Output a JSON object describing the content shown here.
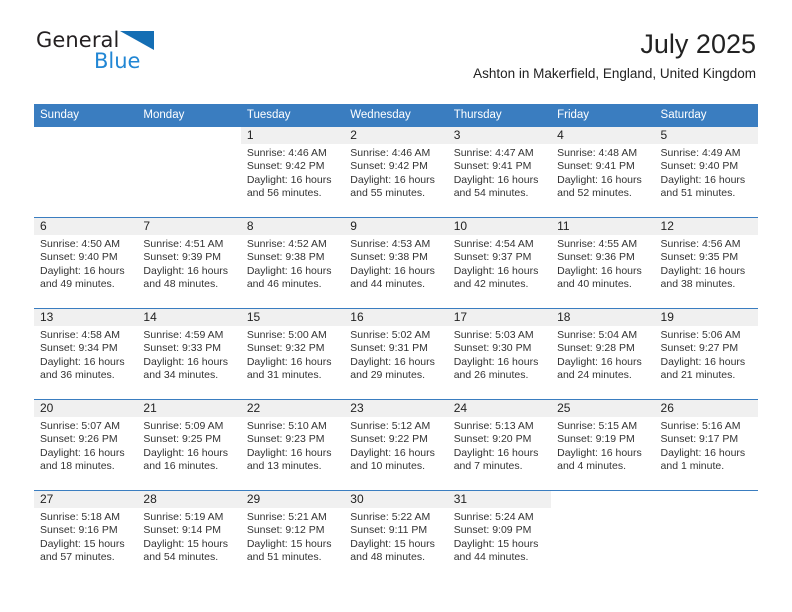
{
  "brand": {
    "name_top": "General",
    "name_bottom": "Blue",
    "accent_color": "#2186d4",
    "triangle_color": "#146eb4"
  },
  "header": {
    "month_title": "July 2025",
    "location": "Ashton in Makerfield, England, United Kingdom"
  },
  "calendar": {
    "header_bg": "#3a7dc0",
    "daynum_bg": "#f0f0f0",
    "weekday_headers": [
      "Sunday",
      "Monday",
      "Tuesday",
      "Wednesday",
      "Thursday",
      "Friday",
      "Saturday"
    ],
    "labels": {
      "sunrise": "Sunrise:",
      "sunset": "Sunset:",
      "daylight": "Daylight:"
    },
    "weeks": [
      [
        {
          "day": "",
          "blank": true
        },
        {
          "day": "",
          "blank": true
        },
        {
          "day": "1",
          "sunrise": "Sunrise: 4:46 AM",
          "sunset": "Sunset: 9:42 PM",
          "daylight_line1": "Daylight: 16 hours",
          "daylight_line2": "and 56 minutes."
        },
        {
          "day": "2",
          "sunrise": "Sunrise: 4:46 AM",
          "sunset": "Sunset: 9:42 PM",
          "daylight_line1": "Daylight: 16 hours",
          "daylight_line2": "and 55 minutes."
        },
        {
          "day": "3",
          "sunrise": "Sunrise: 4:47 AM",
          "sunset": "Sunset: 9:41 PM",
          "daylight_line1": "Daylight: 16 hours",
          "daylight_line2": "and 54 minutes."
        },
        {
          "day": "4",
          "sunrise": "Sunrise: 4:48 AM",
          "sunset": "Sunset: 9:41 PM",
          "daylight_line1": "Daylight: 16 hours",
          "daylight_line2": "and 52 minutes."
        },
        {
          "day": "5",
          "sunrise": "Sunrise: 4:49 AM",
          "sunset": "Sunset: 9:40 PM",
          "daylight_line1": "Daylight: 16 hours",
          "daylight_line2": "and 51 minutes."
        }
      ],
      [
        {
          "day": "6",
          "sunrise": "Sunrise: 4:50 AM",
          "sunset": "Sunset: 9:40 PM",
          "daylight_line1": "Daylight: 16 hours",
          "daylight_line2": "and 49 minutes."
        },
        {
          "day": "7",
          "sunrise": "Sunrise: 4:51 AM",
          "sunset": "Sunset: 9:39 PM",
          "daylight_line1": "Daylight: 16 hours",
          "daylight_line2": "and 48 minutes."
        },
        {
          "day": "8",
          "sunrise": "Sunrise: 4:52 AM",
          "sunset": "Sunset: 9:38 PM",
          "daylight_line1": "Daylight: 16 hours",
          "daylight_line2": "and 46 minutes."
        },
        {
          "day": "9",
          "sunrise": "Sunrise: 4:53 AM",
          "sunset": "Sunset: 9:38 PM",
          "daylight_line1": "Daylight: 16 hours",
          "daylight_line2": "and 44 minutes."
        },
        {
          "day": "10",
          "sunrise": "Sunrise: 4:54 AM",
          "sunset": "Sunset: 9:37 PM",
          "daylight_line1": "Daylight: 16 hours",
          "daylight_line2": "and 42 minutes."
        },
        {
          "day": "11",
          "sunrise": "Sunrise: 4:55 AM",
          "sunset": "Sunset: 9:36 PM",
          "daylight_line1": "Daylight: 16 hours",
          "daylight_line2": "and 40 minutes."
        },
        {
          "day": "12",
          "sunrise": "Sunrise: 4:56 AM",
          "sunset": "Sunset: 9:35 PM",
          "daylight_line1": "Daylight: 16 hours",
          "daylight_line2": "and 38 minutes."
        }
      ],
      [
        {
          "day": "13",
          "sunrise": "Sunrise: 4:58 AM",
          "sunset": "Sunset: 9:34 PM",
          "daylight_line1": "Daylight: 16 hours",
          "daylight_line2": "and 36 minutes."
        },
        {
          "day": "14",
          "sunrise": "Sunrise: 4:59 AM",
          "sunset": "Sunset: 9:33 PM",
          "daylight_line1": "Daylight: 16 hours",
          "daylight_line2": "and 34 minutes."
        },
        {
          "day": "15",
          "sunrise": "Sunrise: 5:00 AM",
          "sunset": "Sunset: 9:32 PM",
          "daylight_line1": "Daylight: 16 hours",
          "daylight_line2": "and 31 minutes."
        },
        {
          "day": "16",
          "sunrise": "Sunrise: 5:02 AM",
          "sunset": "Sunset: 9:31 PM",
          "daylight_line1": "Daylight: 16 hours",
          "daylight_line2": "and 29 minutes."
        },
        {
          "day": "17",
          "sunrise": "Sunrise: 5:03 AM",
          "sunset": "Sunset: 9:30 PM",
          "daylight_line1": "Daylight: 16 hours",
          "daylight_line2": "and 26 minutes."
        },
        {
          "day": "18",
          "sunrise": "Sunrise: 5:04 AM",
          "sunset": "Sunset: 9:28 PM",
          "daylight_line1": "Daylight: 16 hours",
          "daylight_line2": "and 24 minutes."
        },
        {
          "day": "19",
          "sunrise": "Sunrise: 5:06 AM",
          "sunset": "Sunset: 9:27 PM",
          "daylight_line1": "Daylight: 16 hours",
          "daylight_line2": "and 21 minutes."
        }
      ],
      [
        {
          "day": "20",
          "sunrise": "Sunrise: 5:07 AM",
          "sunset": "Sunset: 9:26 PM",
          "daylight_line1": "Daylight: 16 hours",
          "daylight_line2": "and 18 minutes."
        },
        {
          "day": "21",
          "sunrise": "Sunrise: 5:09 AM",
          "sunset": "Sunset: 9:25 PM",
          "daylight_line1": "Daylight: 16 hours",
          "daylight_line2": "and 16 minutes."
        },
        {
          "day": "22",
          "sunrise": "Sunrise: 5:10 AM",
          "sunset": "Sunset: 9:23 PM",
          "daylight_line1": "Daylight: 16 hours",
          "daylight_line2": "and 13 minutes."
        },
        {
          "day": "23",
          "sunrise": "Sunrise: 5:12 AM",
          "sunset": "Sunset: 9:22 PM",
          "daylight_line1": "Daylight: 16 hours",
          "daylight_line2": "and 10 minutes."
        },
        {
          "day": "24",
          "sunrise": "Sunrise: 5:13 AM",
          "sunset": "Sunset: 9:20 PM",
          "daylight_line1": "Daylight: 16 hours",
          "daylight_line2": "and 7 minutes."
        },
        {
          "day": "25",
          "sunrise": "Sunrise: 5:15 AM",
          "sunset": "Sunset: 9:19 PM",
          "daylight_line1": "Daylight: 16 hours",
          "daylight_line2": "and 4 minutes."
        },
        {
          "day": "26",
          "sunrise": "Sunrise: 5:16 AM",
          "sunset": "Sunset: 9:17 PM",
          "daylight_line1": "Daylight: 16 hours",
          "daylight_line2": "and 1 minute."
        }
      ],
      [
        {
          "day": "27",
          "sunrise": "Sunrise: 5:18 AM",
          "sunset": "Sunset: 9:16 PM",
          "daylight_line1": "Daylight: 15 hours",
          "daylight_line2": "and 57 minutes."
        },
        {
          "day": "28",
          "sunrise": "Sunrise: 5:19 AM",
          "sunset": "Sunset: 9:14 PM",
          "daylight_line1": "Daylight: 15 hours",
          "daylight_line2": "and 54 minutes."
        },
        {
          "day": "29",
          "sunrise": "Sunrise: 5:21 AM",
          "sunset": "Sunset: 9:12 PM",
          "daylight_line1": "Daylight: 15 hours",
          "daylight_line2": "and 51 minutes."
        },
        {
          "day": "30",
          "sunrise": "Sunrise: 5:22 AM",
          "sunset": "Sunset: 9:11 PM",
          "daylight_line1": "Daylight: 15 hours",
          "daylight_line2": "and 48 minutes."
        },
        {
          "day": "31",
          "sunrise": "Sunrise: 5:24 AM",
          "sunset": "Sunset: 9:09 PM",
          "daylight_line1": "Daylight: 15 hours",
          "daylight_line2": "and 44 minutes."
        },
        {
          "day": "",
          "blank": true
        },
        {
          "day": "",
          "blank": true
        }
      ]
    ]
  }
}
